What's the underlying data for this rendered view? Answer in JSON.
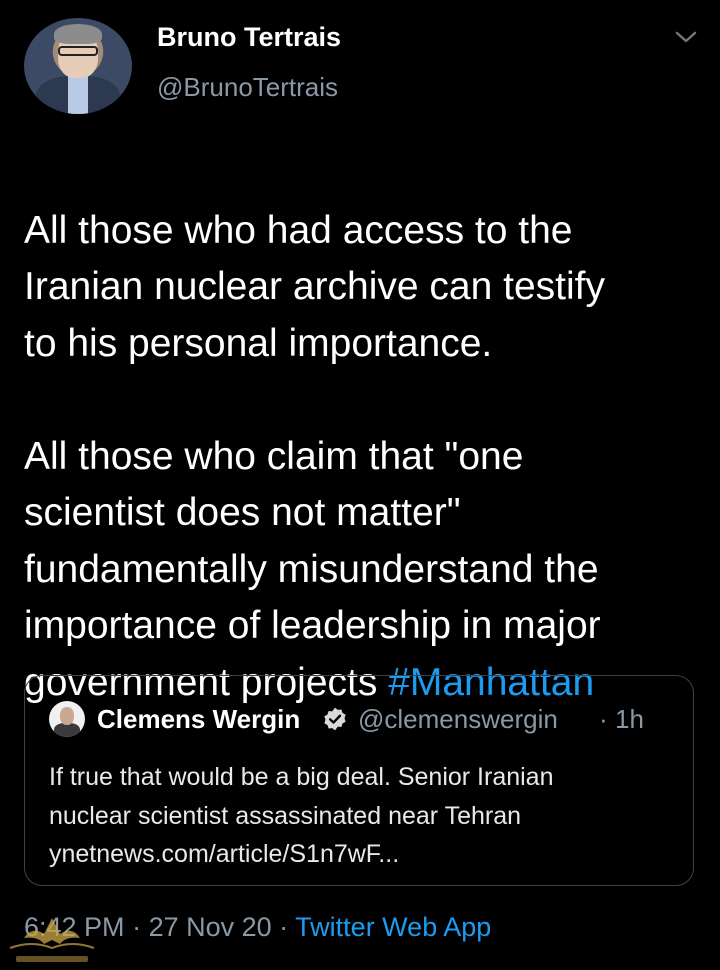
{
  "tweet": {
    "display_name": "Bruno Tertrais",
    "handle": "@BrunoTertrais",
    "avatar_icon": "avatar-photo",
    "menu_icon": "chevron-down-icon",
    "paragraph1": "All those who had access to the\nIranian nuclear archive can testify\nto his personal importance.",
    "paragraph2": "All those who claim that \"one\nscientist does not matter\"\nfundamentally misunderstand the\nimportance of leadership in major\ngovernment projects ",
    "hashtag": "#Manhattan"
  },
  "quoted_tweet": {
    "display_name": "Clemens Wergin",
    "verified_icon": "verified-badge-icon",
    "handle": "@clemenswergin",
    "separator": "·",
    "time": "1h",
    "lines": [
      "If true that would be a big deal. Senior Iranian",
      "nuclear scientist assassinated near Tehran",
      "ynetnews.com/article/S1n7wF..."
    ]
  },
  "footer": {
    "time": "6:42 PM",
    "sep1": " · ",
    "date": "27 Nov 20",
    "sep2": " · ",
    "app": "Twitter Web App"
  },
  "colors": {
    "background": "#000000",
    "text": "#ffffff",
    "secondary": "#8b98a5",
    "accent": "#1d9bf0",
    "border": "#38444d"
  }
}
